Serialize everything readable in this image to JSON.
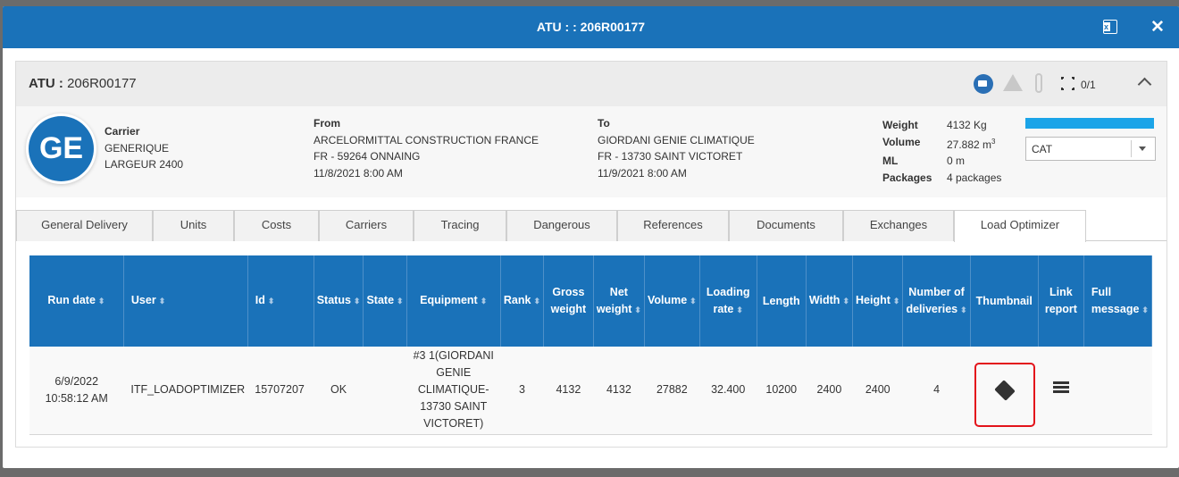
{
  "window": {
    "title": "ATU : : 206R00177"
  },
  "panel": {
    "atu_label": "ATU :",
    "atu_value": "206R00177",
    "count": "0/1"
  },
  "carrier": {
    "initials": "GE",
    "label": "Carrier",
    "name": "GENERIQUE",
    "detail": "LARGEUR 2400"
  },
  "from": {
    "label": "From",
    "company": "ARCELORMITTAL CONSTRUCTION FRANCE",
    "address": "FR - 59264 ONNAING",
    "date": "11/8/2021 8:00 AM"
  },
  "to": {
    "label": "To",
    "company": "GIORDANI GENIE CLIMATIQUE",
    "address": "FR - 13730 SAINT VICTORET",
    "date": "11/9/2021 8:00 AM"
  },
  "metrics": {
    "weight_label": "Weight",
    "weight": "4132 Kg",
    "volume_label": "Volume",
    "volume": "27.882 m",
    "volume_unit_sup": "3",
    "ml_label": "ML",
    "ml": "0 m",
    "packages_label": "Packages",
    "packages": "4 packages",
    "fill_fraction": 1.0,
    "fill_color": "#1ba4e8"
  },
  "category_select": {
    "value": "CAT"
  },
  "tabs": [
    "General Delivery",
    "Units",
    "Costs",
    "Carriers",
    "Tracing",
    "Dangerous",
    "References",
    "Documents",
    "Exchanges",
    "Load Optimizer"
  ],
  "active_tab": "Load Optimizer",
  "table": {
    "headers": [
      "Run date",
      "User",
      "Id",
      "Status",
      "State",
      "Equipment",
      "Rank",
      "Gross weight",
      "Net weight",
      "Volume",
      "Loading rate",
      "Length",
      "Width",
      "Height",
      "Number of deliveries",
      "Thumbnail",
      "Link report",
      "Full message"
    ],
    "row": {
      "run_date_1": "6/9/2022",
      "run_date_2": "10:58:12 AM",
      "user": "ITF_LOADOPTIMIZER",
      "id": "15707207",
      "status": "OK",
      "state": "",
      "equipment_1": "#3 1(GIORDANI",
      "equipment_2": "GENIE",
      "equipment_3": "CLIMATIQUE-",
      "equipment_4": "13730 SAINT",
      "equipment_5": "VICTORET)",
      "rank": "3",
      "gross_weight": "4132",
      "net_weight": "4132",
      "volume": "27882",
      "loading_rate": "32.400",
      "length": "10200",
      "width": "2400",
      "height": "2400",
      "deliveries": "4"
    }
  },
  "colors": {
    "primary": "#1a72b9",
    "highlight": "#e3131b"
  },
  "icons": {
    "excel": "excel-export-icon",
    "close": "close-icon",
    "thumbnail": "cube-icon",
    "report": "list-icon"
  }
}
